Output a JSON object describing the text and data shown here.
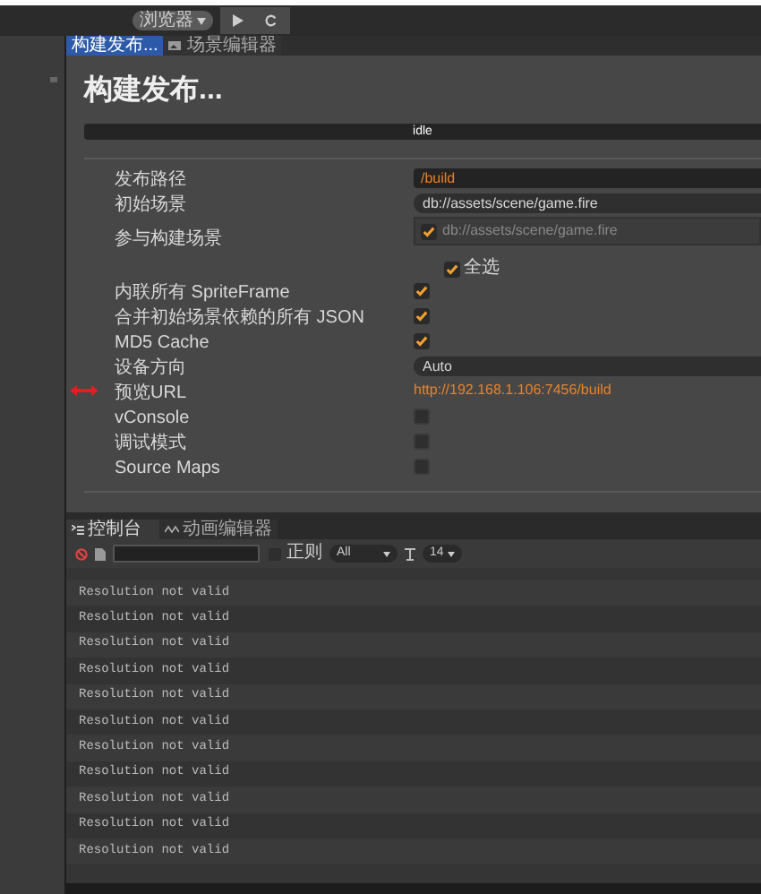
{
  "toolbar": {
    "platform": "浏览器"
  },
  "tabs": [
    {
      "label": "构建发布...",
      "selected": true
    },
    {
      "label": "场景编辑器",
      "selected": false
    }
  ],
  "build": {
    "title": "构建发布...",
    "status": "idle",
    "fields": [
      {
        "kind": "path",
        "label": "发布路径",
        "value": "/build"
      },
      {
        "kind": "select",
        "label": "初始场景",
        "value": "db://assets/scene/game.fire"
      },
      {
        "kind": "scenes",
        "label": "参与构建场景",
        "scenes": [
          {
            "path": "db://assets/scene/game.fire",
            "checked": true
          }
        ],
        "select_all": {
          "label": "全选",
          "checked": true
        }
      },
      {
        "kind": "checkbox",
        "label": "内联所有 SpriteFrame",
        "checked": true
      },
      {
        "kind": "checkbox",
        "label": "合并初始场景依赖的所有 JSON",
        "checked": true
      },
      {
        "kind": "checkbox",
        "label": "MD5 Cache",
        "checked": true
      },
      {
        "kind": "select",
        "label": "设备方向",
        "value": "Auto"
      },
      {
        "kind": "link",
        "label": "预览URL",
        "value": "http://192.168.1.106:7456/build",
        "marked": true
      },
      {
        "kind": "checkbox",
        "label": "vConsole",
        "checked": false
      },
      {
        "kind": "checkbox",
        "label": "调试模式",
        "checked": false
      },
      {
        "kind": "checkbox",
        "label": "Source Maps",
        "checked": false
      }
    ]
  },
  "console": {
    "tabs": [
      {
        "label": "控制台",
        "selected": true
      },
      {
        "label": "动画编辑器",
        "selected": false
      }
    ],
    "filter": {
      "regex_label": "正则",
      "regex_checked": false,
      "level": "All",
      "font_size": "14"
    },
    "logs": [
      "Resolution not valid",
      "Resolution not valid",
      "Resolution not valid",
      "Resolution not valid",
      "Resolution not valid",
      "Resolution not valid",
      "Resolution not valid",
      "Resolution not valid",
      "Resolution not valid",
      "Resolution not valid",
      "Resolution not valid"
    ]
  }
}
